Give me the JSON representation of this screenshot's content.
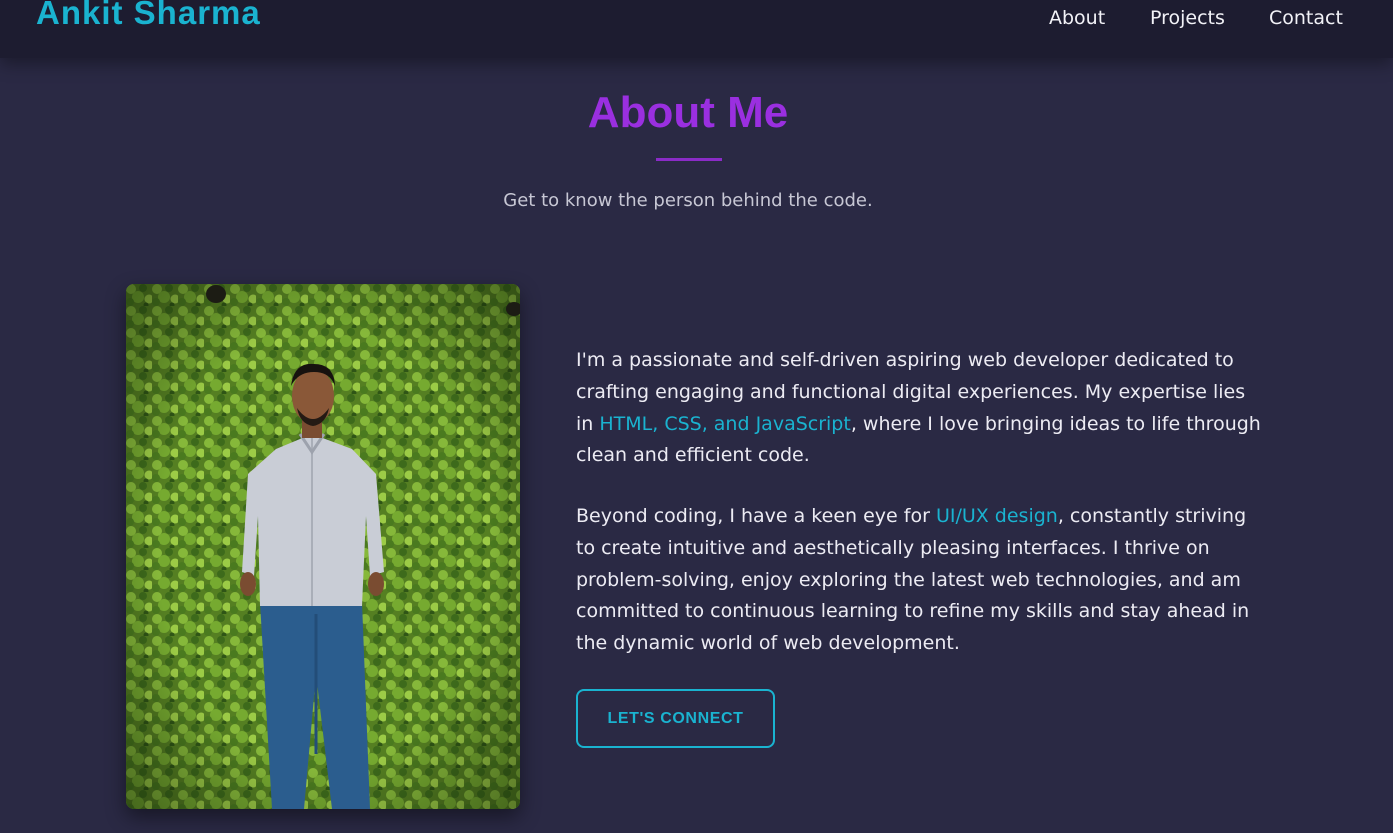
{
  "header": {
    "brand": "Ankit Sharma",
    "nav": [
      {
        "label": "About"
      },
      {
        "label": "Projects"
      },
      {
        "label": "Contact"
      }
    ]
  },
  "about": {
    "title": "About Me",
    "subtitle": "Get to know the person behind the code.",
    "paragraph1": {
      "before": "I'm a passionate and self-driven aspiring web developer dedicated to crafting engaging and functional digital experiences. My expertise lies in ",
      "highlight": "HTML, CSS, and JavaScript",
      "after": ", where I love bringing ideas to life through clean and efficient code."
    },
    "paragraph2": {
      "before": "Beyond coding, I have a keen eye for ",
      "highlight": "UI/UX design",
      "after": ", constantly striving to create intuitive and aesthetically pleasing interfaces. I thrive on problem-solving, enjoy exploring the latest web technologies, and am committed to continuous learning to refine my skills and stay ahead in the dynamic world of web development."
    },
    "cta_label": "LET'S CONNECT"
  },
  "colors": {
    "page_background": "#2a2944",
    "nav_background": "#1d1c30",
    "accent_cyan": "#1ab3d0",
    "accent_purple": "#9a2fe0"
  }
}
